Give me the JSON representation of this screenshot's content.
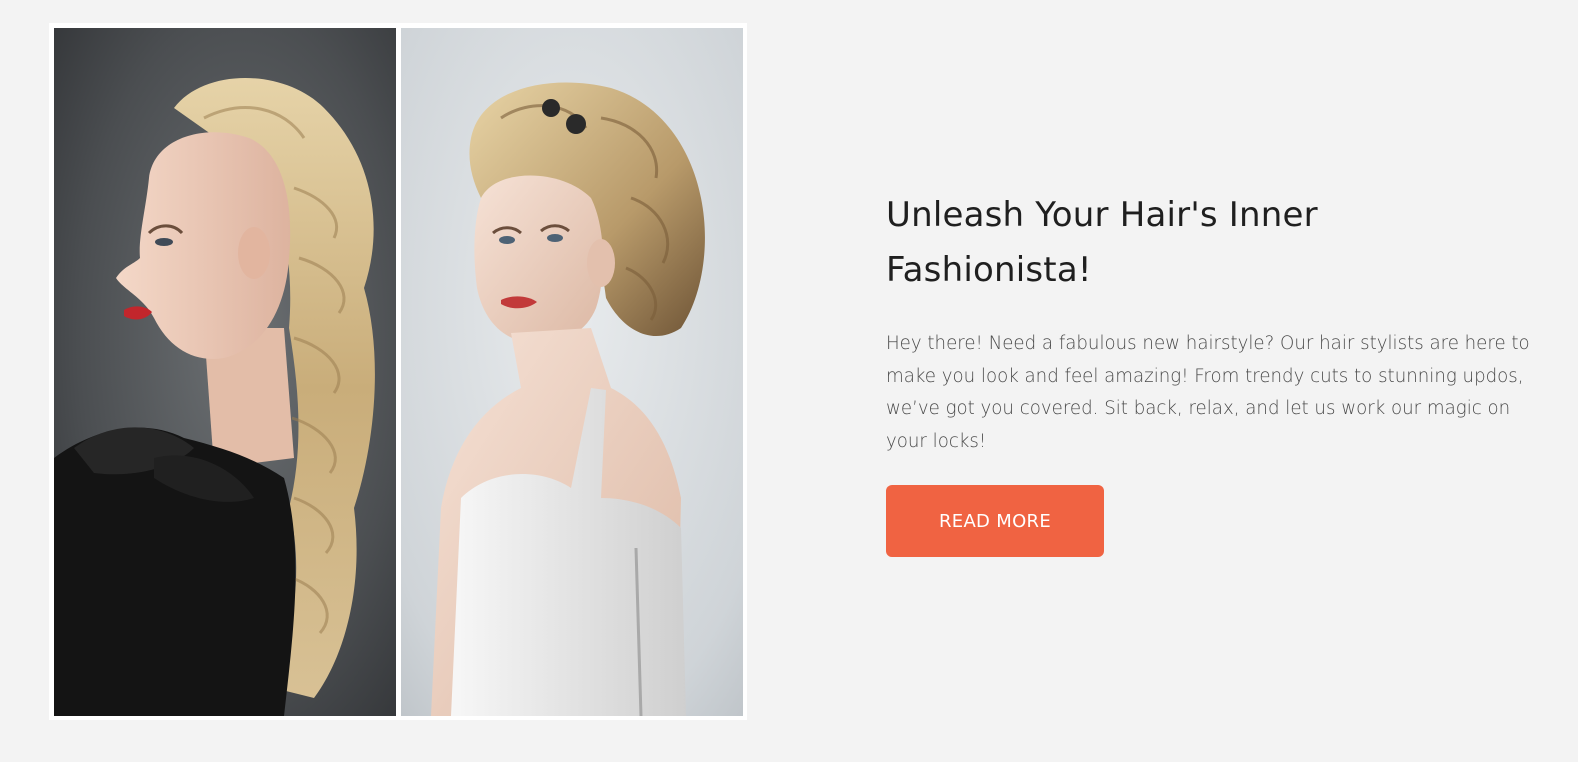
{
  "section": {
    "title": "Unleash Your Hair's Inner Fashionista!",
    "description": "Hey there! Need a fabulous new hairstyle? Our hair stylists are here to make you look and feel amazing! From trendy cuts to stunning updos, we’ve got you covered. Sit back, relax, and let us work our magic on your locks!",
    "button_label": "READ MORE"
  },
  "colors": {
    "page_background": "#f3f3f3",
    "button_background": "#f06342",
    "button_text": "#ffffff",
    "title_text": "#1f1f1f",
    "body_text": "#4a4a4a"
  },
  "images": [
    {
      "name": "model-braided-blonde-black-dress-photo"
    },
    {
      "name": "model-vintage-updo-white-dress-photo"
    }
  ]
}
